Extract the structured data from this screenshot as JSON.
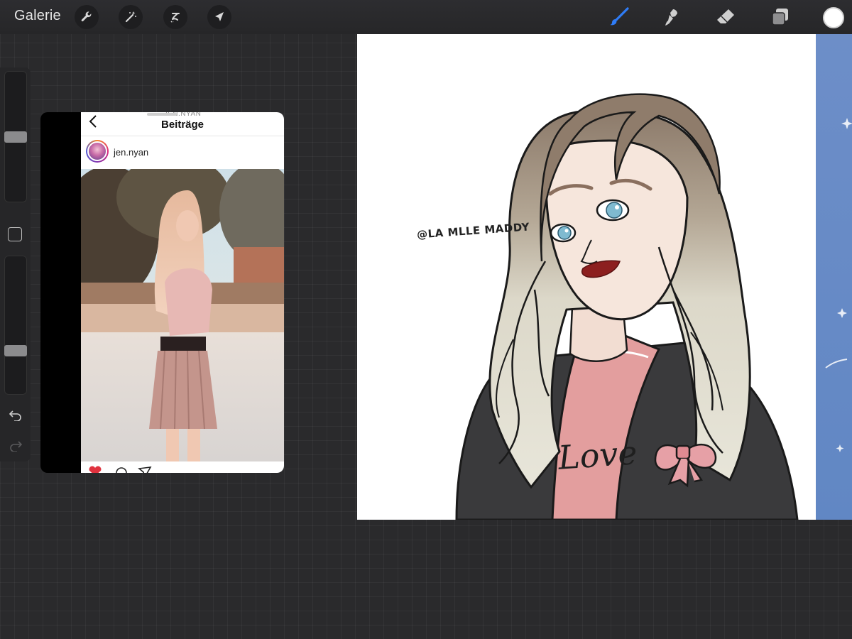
{
  "toolbar": {
    "gallery_label": "Galerie",
    "left_tools": [
      "wrench-icon",
      "magic-wand-icon",
      "selection-icon",
      "transform-arrow-icon"
    ],
    "right_tools": [
      "brush-icon",
      "smudge-icon",
      "eraser-icon",
      "layers-icon"
    ],
    "active_tool": "brush-icon",
    "active_color": "#ffffff",
    "accent_color": "#2f7cf6"
  },
  "sidebar": {
    "brush_size_level": 0.5,
    "opacity_level": 0.3
  },
  "reference": {
    "top_username": "JEN.NYAN",
    "title": "Beiträge",
    "post_username": "jen.nyan"
  },
  "canvas": {
    "signature": "@LA MLLE MADDY",
    "shirt_text": "Love"
  }
}
